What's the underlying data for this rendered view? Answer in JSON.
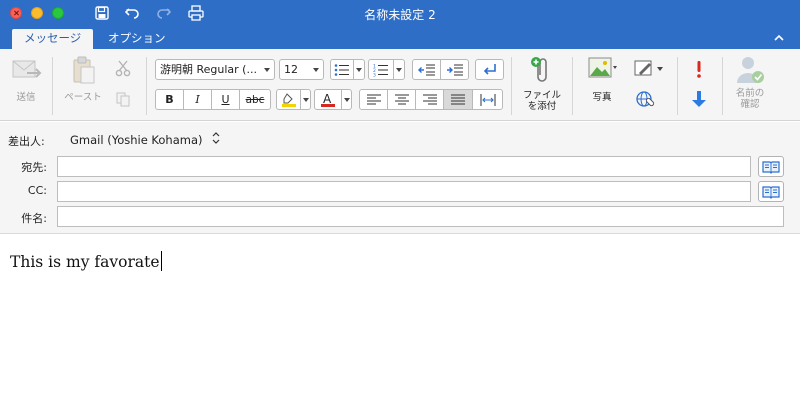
{
  "window": {
    "title": "名称未設定 2"
  },
  "tabs": [
    {
      "label": "メッセージ",
      "active": true
    },
    {
      "label": "オプション",
      "active": false
    }
  ],
  "ribbon": {
    "send_label": "送信",
    "paste_label": "ペースト",
    "font_name": "游明朝 Regular (...",
    "font_size": "12",
    "bold": "B",
    "italic": "I",
    "underline": "U",
    "strike": "abc",
    "text_color_glyph": "A",
    "attach_label_1": "ファイル",
    "attach_label_2": "を添付",
    "picture_label": "写真",
    "check_names_label_1": "名前の",
    "check_names_label_2": "確認",
    "highlight_color": "#f4d400",
    "font_color": "#d9281f",
    "importance_high_color": "#d9281f",
    "importance_low_color": "#2c7be5"
  },
  "header": {
    "from_label": "差出人:",
    "from_value": "Gmail (Yoshie Kohama)",
    "to_label": "宛先:",
    "to_value": "",
    "cc_label": "CC:",
    "cc_value": "",
    "subject_label": "件名:",
    "subject_value": ""
  },
  "body": {
    "text": "This is my favorate"
  },
  "colors": {
    "titlebar": "#2e6ec6",
    "ribbon_bg": "#f5f5f5"
  }
}
